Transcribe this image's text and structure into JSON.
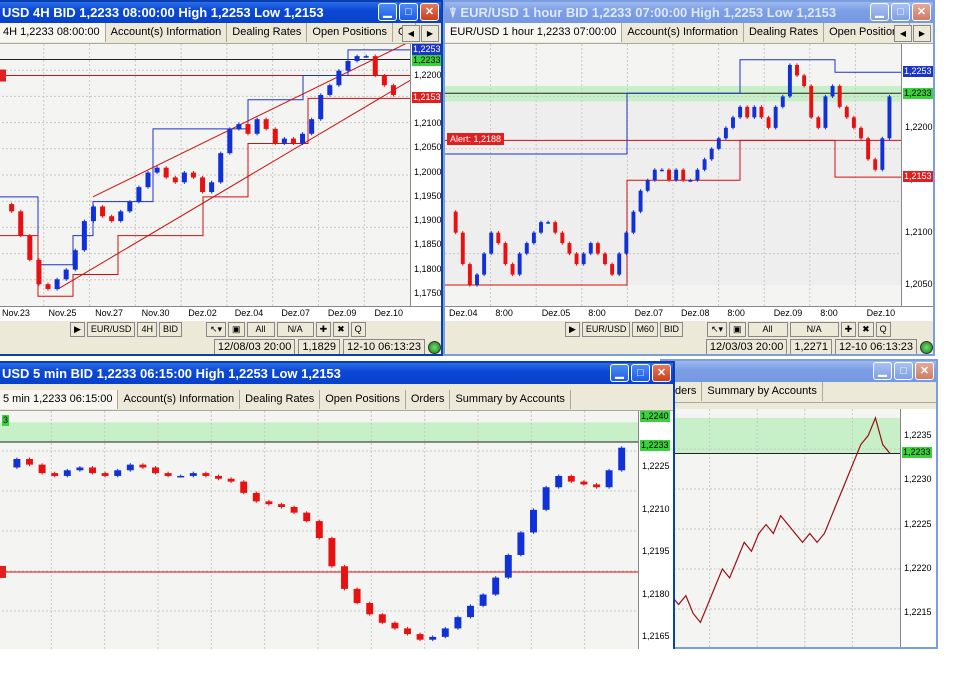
{
  "colors": {
    "bull": "#1030d8",
    "bear": "#e81010",
    "channel_blue": "#1c34c8",
    "channel_red": "#d01010",
    "green_zone": "#c8f0c8"
  },
  "win1": {
    "title": "USD 4H BID 1,2233 08:00:00 High 1,2253 Low 1,2153",
    "tabs": [
      "4H 1,2233 08:00:00",
      "Account(s) Information",
      "Dealing Rates",
      "Open Positions",
      "Or"
    ],
    "price_tags": {
      "blue": "1,2253",
      "green": "1,2233",
      "red": "1,2153"
    },
    "y_labels": [
      "1,2200",
      "1,2150",
      "1,2100",
      "1,2050",
      "1,2000",
      "1,1950",
      "1,1900",
      "1,1850",
      "1,1800",
      "1,1750"
    ],
    "x_labels": [
      "Nov.23",
      "Nov.25",
      "Nov.27",
      "Nov.30",
      "Dez.02",
      "Dez.04",
      "Dez.07",
      "Dez.09",
      "Dez.10"
    ],
    "toolbar": {
      "symbol": "EUR/USD",
      "period": "4H",
      "side": "BID",
      "all": "All",
      "na": "N/A",
      "q": "Q"
    },
    "status": {
      "datetime": "12/08/03 20:00",
      "price": "1,1829",
      "time": "12-10 06:13:23"
    }
  },
  "win2": {
    "title": "EUR/USD 1 hour BID 1,2233 07:00:00 High 1,2253 Low 1,2153",
    "tabs": [
      "EUR/USD 1 hour 1,2233 07:00:00",
      "Account(s) Information",
      "Dealing Rates",
      "Open Positions"
    ],
    "alert_label": "Alert: 1,2188",
    "price_tags": {
      "blue": "1,2253",
      "green": "1,2233",
      "red": "1,2153"
    },
    "y_labels": [
      "1,2200",
      "1,2150",
      "1,2100",
      "1,2050"
    ],
    "x_labels": [
      "Dez.04",
      "8:00",
      "Dez.05",
      "8:00",
      "Dez.07",
      "Dez.08",
      "8:00",
      "Dez.09",
      "8:00",
      "Dez.10"
    ],
    "toolbar": {
      "symbol": "EUR/USD",
      "period": "M60",
      "side": "BID",
      "all": "All",
      "na": "N/A",
      "q": "Q"
    },
    "status": {
      "datetime": "12/03/03 20:00",
      "price": "1,2271",
      "time": "12-10 06:13:23"
    }
  },
  "win3": {
    "title": "USD 5 min BID 1,2233 06:15:00 High 1,2253 Low 1,2153",
    "tabs": [
      "5 min 1,2233 06:15:00",
      "Account(s) Information",
      "Dealing Rates",
      "Open Positions",
      "Orders",
      "Summary by Accounts"
    ],
    "price_tag_top": "1,2240",
    "price_tag_green": "1,2233",
    "left_tag": "3",
    "y_labels": [
      "1,2225",
      "1,2210",
      "1,2195",
      "1,2180",
      "1,2165"
    ]
  },
  "win4": {
    "tabs": [
      "ders",
      "Summary by Accounts"
    ],
    "price_tag_green": "1,2233",
    "y_labels": [
      "1,2235",
      "1,2230",
      "1,2225",
      "1,2220",
      "1,2215"
    ]
  },
  "chart_data": [
    {
      "type": "candlestick",
      "title": "USD 4H BID 1,2233 08:00:00 High 1,2253 Low 1,2153",
      "ylim": [
        1.1725,
        1.2265
      ],
      "categories": [
        "Nov.23",
        "Nov.25",
        "Nov.27",
        "Nov.30",
        "Dez.02",
        "Dez.04",
        "Dez.07",
        "Dez.09",
        "Dez.10"
      ],
      "series": [
        {
          "values": [
            1.1935,
            1.192,
            1.187,
            1.182,
            1.177,
            1.176,
            1.178,
            1.18,
            1.184,
            1.19,
            1.193,
            1.191,
            1.19,
            1.192,
            1.194,
            1.197,
            1.2,
            1.201,
            1.199,
            1.198,
            1.2,
            1.199,
            1.196,
            1.198,
            1.204,
            1.209,
            1.21,
            1.208,
            1.211,
            1.209,
            1.206,
            1.207,
            1.206,
            1.208,
            1.211,
            1.216,
            1.218,
            1.221,
            1.223,
            1.224,
            1.224,
            1.22,
            1.218,
            1.216
          ]
        }
      ],
      "horizontal_lines": [
        1.2233,
        1.22,
        1.2153
      ]
    },
    {
      "type": "candlestick",
      "title": "EUR/USD 1 hour BID 1,2233 07:00:00 High 1,2253 Low 1,2153",
      "ylim": [
        1.203,
        1.228
      ],
      "categories": [
        "Dez.04",
        "8:00",
        "Dez.05",
        "8:00",
        "Dez.07",
        "Dez.08",
        "8:00",
        "Dez.09",
        "8:00",
        "Dez.10"
      ],
      "series": [
        {
          "values": [
            1.212,
            1.21,
            1.207,
            1.205,
            1.206,
            1.208,
            1.21,
            1.209,
            1.207,
            1.206,
            1.208,
            1.209,
            1.21,
            1.211,
            1.211,
            1.21,
            1.209,
            1.208,
            1.207,
            1.208,
            1.209,
            1.208,
            1.207,
            1.206,
            1.208,
            1.21,
            1.212,
            1.214,
            1.215,
            1.216,
            1.216,
            1.215,
            1.216,
            1.215,
            1.215,
            1.216,
            1.217,
            1.218,
            1.219,
            1.22,
            1.221,
            1.222,
            1.221,
            1.222,
            1.221,
            1.22,
            1.222,
            1.223,
            1.226,
            1.225,
            1.224,
            1.221,
            1.22,
            1.223,
            1.224,
            1.222,
            1.221,
            1.22,
            1.219,
            1.217,
            1.216,
            1.219,
            1.223
          ]
        }
      ],
      "horizontal_lines": [
        1.2253,
        1.2233,
        1.2188,
        1.2153
      ]
    },
    {
      "type": "candlestick",
      "title": "USD 5 min BID 1,2233 06:15:00 High 1,2253 Low 1,2153",
      "ylim": [
        1.216,
        1.2245
      ],
      "series": [
        {
          "values": [
            1.2225,
            1.2228,
            1.2226,
            1.2223,
            1.2222,
            1.2224,
            1.2225,
            1.2223,
            1.2222,
            1.2224,
            1.2226,
            1.2225,
            1.2223,
            1.2222,
            1.2222,
            1.2223,
            1.2222,
            1.2221,
            1.222,
            1.2216,
            1.2213,
            1.2212,
            1.2211,
            1.2209,
            1.2206,
            1.22,
            1.219,
            1.2182,
            1.2177,
            1.2173,
            1.217,
            1.2168,
            1.2166,
            1.2164,
            1.2165,
            1.2168,
            1.2172,
            1.2176,
            1.218,
            1.2186,
            1.2194,
            1.2202,
            1.221,
            1.2218,
            1.2222,
            1.222,
            1.2219,
            1.2218,
            1.2224,
            1.2232
          ]
        }
      ],
      "horizontal_lines": [
        1.2233,
        1.2188
      ]
    },
    {
      "type": "line",
      "ylim": [
        1.2211,
        1.2238
      ],
      "series": [
        {
          "values": [
            1.2216,
            1.2217,
            1.2216,
            1.2217,
            1.2215,
            1.2214,
            1.2216,
            1.2218,
            1.222,
            1.2219,
            1.2221,
            1.2223,
            1.2222,
            1.2224,
            1.2225,
            1.2224,
            1.2226,
            1.2225,
            1.2224,
            1.2223,
            1.2224,
            1.2223,
            1.2224,
            1.2226,
            1.2228,
            1.223,
            1.2232,
            1.2234,
            1.2235,
            1.2237,
            1.2234,
            1.2233
          ]
        }
      ],
      "horizontal_lines": [
        1.2233
      ]
    }
  ]
}
